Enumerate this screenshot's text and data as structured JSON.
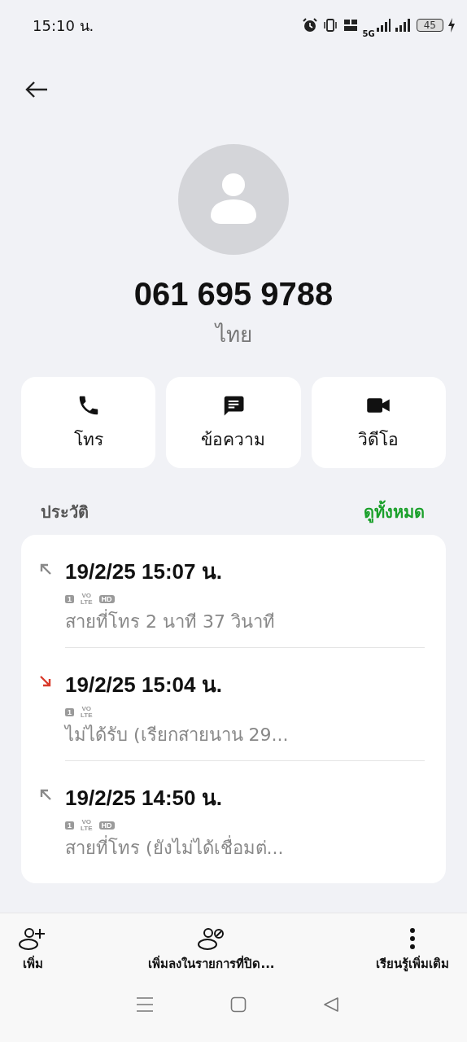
{
  "status_bar": {
    "time": "15:10 น.",
    "network": "5G",
    "battery": "45",
    "charging": true
  },
  "contact": {
    "number": "061 695 9788",
    "location": "ไทย"
  },
  "actions": [
    {
      "kind": "call",
      "label": "โทร"
    },
    {
      "kind": "message",
      "label": "ข้อความ"
    },
    {
      "kind": "video",
      "label": "วิดีโอ"
    }
  ],
  "history": {
    "title": "ประวัติ",
    "view_all": "ดูทั้งหมด",
    "calls": [
      {
        "kind": "outgoing",
        "time": "19/2/25 15:07 น.",
        "tags": [
          {
            "kind": "sim",
            "text": "1"
          },
          {
            "kind": "stack",
            "text": "VO\nLTE"
          },
          {
            "kind": "box",
            "text": "HD"
          }
        ],
        "detail": "สายที่โทร  2 นาที 37 วินาที"
      },
      {
        "kind": "missed",
        "time": "19/2/25 15:04 น.",
        "tags": [
          {
            "kind": "sim",
            "text": "1"
          },
          {
            "kind": "stack",
            "text": "VO\nLTE"
          }
        ],
        "detail": "ไม่ได้รับ (เรียกสายนาน 29..."
      },
      {
        "kind": "outgoing",
        "time": "19/2/25 14:50 น.",
        "tags": [
          {
            "kind": "sim",
            "text": "1"
          },
          {
            "kind": "stack",
            "text": "VO\nLTE"
          },
          {
            "kind": "box",
            "text": "HD"
          }
        ],
        "detail": "สายที่โทร (ยังไม่ได้เชื่อมต่..."
      }
    ]
  },
  "bottom_actions": [
    {
      "kind": "add",
      "label": "เพิ่ม"
    },
    {
      "kind": "block",
      "label": "เพิ่มลงในรายการที่ปิด..."
    },
    {
      "kind": "more",
      "label": "เรียนรู้เพิ่มเติม"
    }
  ]
}
